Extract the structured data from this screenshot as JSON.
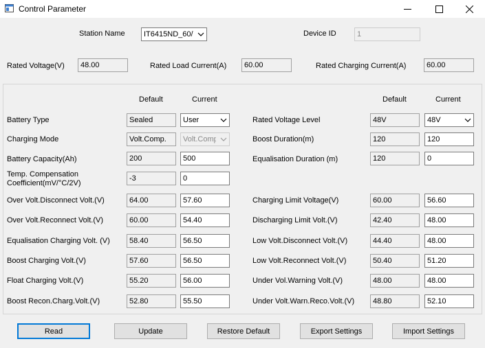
{
  "window": {
    "title": "Control Parameter"
  },
  "station": {
    "label": "Station Name",
    "value": "IT6415ND_60/"
  },
  "device": {
    "label": "Device ID",
    "value": "1"
  },
  "rated": {
    "voltage_label": "Rated Voltage(V)",
    "voltage_value": "48.00",
    "load_current_label": "Rated Load Current(A)",
    "load_current_value": "60.00",
    "charging_current_label": "Rated Charging Current(A)",
    "charging_current_value": "60.00"
  },
  "headers": {
    "default": "Default",
    "current": "Current"
  },
  "left_params": [
    {
      "label": "Battery Type",
      "default": "Sealed",
      "current": "User"
    },
    {
      "label": "Charging Mode",
      "default": "Volt.Comp.",
      "current": "Volt.Comp"
    },
    {
      "label": "Battery Capacity(Ah)",
      "default": "200",
      "current": "500"
    },
    {
      "label": "Temp. Compensation Coefficient(mV/°C/2V)",
      "default": "-3",
      "current": "0"
    },
    {
      "label": "Over Volt.Disconnect Volt.(V)",
      "default": "64.00",
      "current": "57.60"
    },
    {
      "label": "Over Volt.Reconnect Volt.(V)",
      "default": "60.00",
      "current": "54.40"
    },
    {
      "label": "Equalisation Charging Volt. (V)",
      "default": "58.40",
      "current": "56.50"
    },
    {
      "label": "Boost Charging Volt.(V)",
      "default": "57.60",
      "current": "56.50"
    },
    {
      "label": "Float Charging Volt.(V)",
      "default": "55.20",
      "current": "56.00"
    },
    {
      "label": "Boost Recon.Charg.Volt.(V)",
      "default": "52.80",
      "current": "55.50"
    }
  ],
  "right_params": [
    {
      "label": "Rated Voltage Level",
      "default": "48V",
      "current": "48V"
    },
    {
      "label": "Boost Duration(m)",
      "default": "120",
      "current": "120"
    },
    {
      "label": "Equalisation Duration (m)",
      "default": "120",
      "current": "0"
    },
    {
      "label": "Charging Limit Voltage(V)",
      "default": "60.00",
      "current": "56.60"
    },
    {
      "label": "Discharging Limit Volt.(V)",
      "default": "42.40",
      "current": "48.00"
    },
    {
      "label": "Low Volt.Disconnect Volt.(V)",
      "default": "44.40",
      "current": "48.00"
    },
    {
      "label": "Low Volt.Reconnect Volt.(V)",
      "default": "50.40",
      "current": "51.20"
    },
    {
      "label": "Under Vol.Warning Volt.(V)",
      "default": "48.00",
      "current": "48.00"
    },
    {
      "label": "Under Volt.Warn.Reco.Volt.(V)",
      "default": "48.80",
      "current": "52.10"
    }
  ],
  "buttons": {
    "read": "Read",
    "update": "Update",
    "restore": "Restore Default",
    "export": "Export Settings",
    "import": "Import Settings"
  },
  "icons": {
    "app": "app-icon",
    "minimize": "minimize-icon",
    "maximize": "maximize-icon",
    "close": "close-icon",
    "dropdown": "chevron-down-icon"
  }
}
